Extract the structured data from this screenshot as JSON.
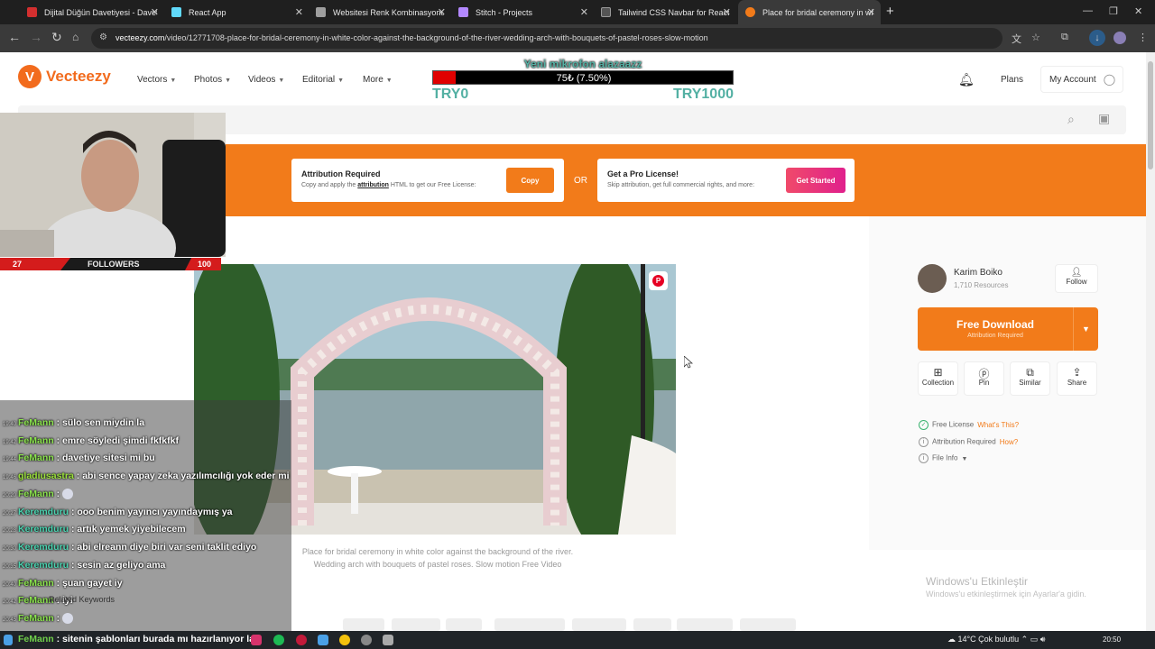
{
  "browser": {
    "tabs": [
      {
        "title": "Dijital Düğün Davetiyesi - Davet",
        "fav_color": "#d32f2f"
      },
      {
        "title": "React App",
        "fav_color": "#61dafb"
      },
      {
        "title": "Websitesi Renk Kombinasyonu",
        "fav_color": "#9e9e9e"
      },
      {
        "title": "Stitch - Projects",
        "fav_color": "#b388ff"
      },
      {
        "title": "Tailwind CSS Navbar for React",
        "fav_color": "#555555"
      },
      {
        "title": "Place for bridal ceremony in wh",
        "fav_color": "#f27b1a"
      }
    ],
    "url_host": "vecteezy.com",
    "url_path": "/video/12771708-place-for-bridal-ceremony-in-white-color-against-the-background-of-the-river-wedding-arch-with-bouquets-of-pastel-roses-slow-motion"
  },
  "site": {
    "logo_text": "Vecteezy",
    "menu": [
      "Vectors",
      "Photos",
      "Videos",
      "Editorial",
      "More"
    ],
    "plans": "Plans",
    "account": "My Account"
  },
  "donation": {
    "message": "Yeni mikrofon alazaazz",
    "value": "75₺ (7.50%)",
    "progress": 0.075,
    "min": "TRY0",
    "max": "TRY1000"
  },
  "banner": {
    "attr_title": "Attribution Required",
    "attr_text_pre": "Copy and apply the ",
    "attr_link": "attribution",
    "attr_text_post": " HTML to get our Free License:",
    "copy_btn": "Copy",
    "or": "OR",
    "pro_title": "Get a Pro License!",
    "pro_text": "Skip attribution, get full commercial rights, and more:",
    "pro_btn": "Get Started"
  },
  "video": {
    "caption": "Place for bridal ceremony in white color against the background of the river. Wedding arch with bouquets of pastel roses. Slow motion Free Video"
  },
  "panel": {
    "author_name": "Karim Boiko",
    "author_resources": "1,710 Resources",
    "follow": "Follow",
    "download": "Free Download",
    "download_sub": "Attribution Required",
    "actions": [
      "Collection",
      "Pin",
      "Similar",
      "Share"
    ],
    "license": "Free License",
    "license_link": "What's This?",
    "attribution": "Attribution Required",
    "attribution_link": "How?",
    "file_info": "File Info"
  },
  "windows": {
    "activate_title": "Windows'u Etkinleştir",
    "activate_sub": "Windows'u etkinleştirmek için Ayarlar'a gidin."
  },
  "stream": {
    "followers_label": "FOLLOWERS",
    "followers_current": "27",
    "followers_goal": "100",
    "chat": [
      {
        "time": "19:40",
        "user": "FeMann",
        "text": ": sülo sen miydin la"
      },
      {
        "time": "19:42",
        "user": "FeMann",
        "text": ": emre söyledi şimdi fkfkfkf"
      },
      {
        "time": "19:44",
        "user": "FeMann",
        "text": ": davetiye sitesi mi bu"
      },
      {
        "time": "19:46",
        "user": "gladiusastra",
        "text": ": abi sence yapay zeka yazılımcılığı yok eder mi"
      },
      {
        "time": "20:20",
        "user": "FeMann",
        "text": ":"
      },
      {
        "time": "20:27",
        "user": "Keremduru",
        "text": ": ooo benim yayıncı yayındaymış ya"
      },
      {
        "time": "20:28",
        "user": "Keremduru",
        "text": ": artık yemek yiyebilecem"
      },
      {
        "time": "20:30",
        "user": "Keremduru",
        "text": ": abi elreann diye biri var seni taklit ediyo"
      },
      {
        "time": "20:35",
        "user": "Keremduru",
        "text": ": sesin az geliyo ama"
      },
      {
        "time": "20:40",
        "user": "FeMann",
        "text": ": şuan gayet iy"
      },
      {
        "time": "20:42",
        "user": "FeMann",
        "text": ": iyi"
      },
      {
        "time": "20:45",
        "user": "FeMann",
        "text": ":"
      }
    ],
    "related": "Related Keywords",
    "last_user": "FeMann",
    "last_text": ": sitenin şablonları burada mı hazırlanıyor la"
  },
  "taskbar": {
    "weather": "14°C  Çok bulutlu",
    "clock": "20:50"
  }
}
